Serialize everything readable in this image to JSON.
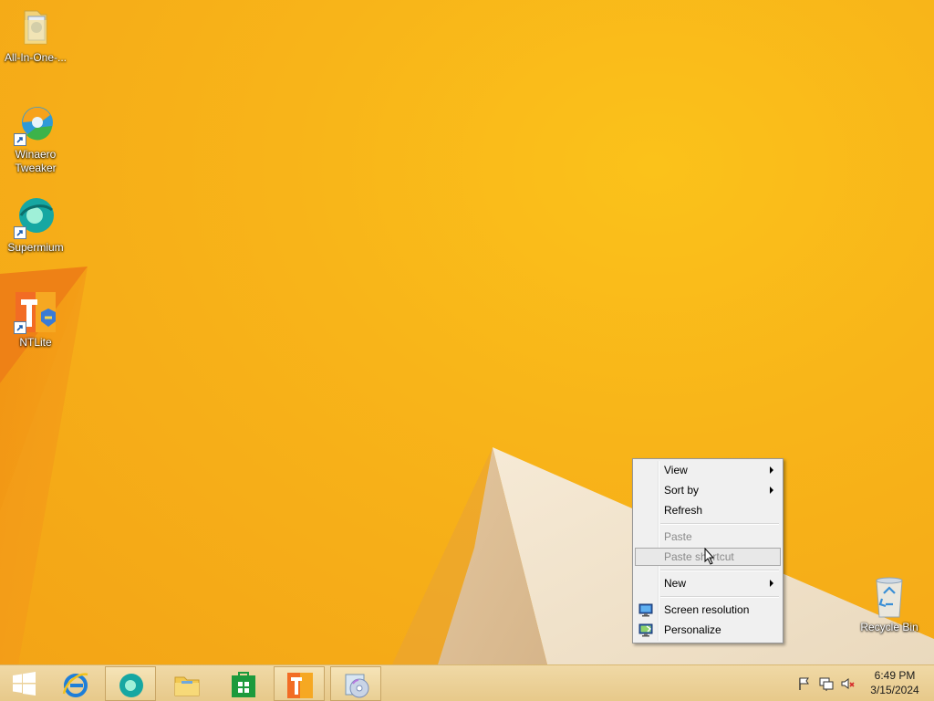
{
  "desktop": {
    "icons": [
      {
        "label": "All-In-One-...",
        "icon": "folder-icon"
      },
      {
        "label": "Winaero\nTweaker",
        "icon": "winaero-tweaker-icon"
      },
      {
        "label": "Supermium",
        "icon": "supermium-icon"
      },
      {
        "label": "NTLite",
        "icon": "ntlite-icon"
      },
      {
        "label": "Recycle Bin",
        "icon": "recycle-bin-icon"
      }
    ]
  },
  "context_menu": {
    "items": [
      {
        "label": "View",
        "submenu": true,
        "enabled": true
      },
      {
        "label": "Sort by",
        "submenu": true,
        "enabled": true
      },
      {
        "label": "Refresh",
        "submenu": false,
        "enabled": true
      },
      {
        "label": "Paste",
        "submenu": false,
        "enabled": false
      },
      {
        "label": "Paste shortcut",
        "submenu": false,
        "enabled": false,
        "highlighted": true
      },
      {
        "label": "New",
        "submenu": true,
        "enabled": true
      },
      {
        "label": "Screen resolution",
        "submenu": false,
        "enabled": true,
        "icon": "display-icon"
      },
      {
        "label": "Personalize",
        "submenu": false,
        "enabled": true,
        "icon": "personalize-icon"
      }
    ]
  },
  "taskbar": {
    "buttons": [
      {
        "name": "start-button",
        "icon": "windows-logo-icon"
      },
      {
        "name": "internet-explorer",
        "icon": "internet-explorer-icon"
      },
      {
        "name": "supermium",
        "icon": "supermium-icon",
        "active": true
      },
      {
        "name": "file-explorer",
        "icon": "file-explorer-icon"
      },
      {
        "name": "store",
        "icon": "store-icon"
      },
      {
        "name": "ntlite",
        "icon": "ntlite-icon",
        "active": true
      },
      {
        "name": "disc-app",
        "icon": "disc-icon",
        "active": true
      }
    ],
    "tray": {
      "icons": [
        "flag-icon",
        "network-icon",
        "volume-muted-icon"
      ],
      "time": "6:49 PM",
      "date": "3/15/2024"
    }
  },
  "colors": {
    "wallpaper": "#f8b419",
    "taskbar": "#ebcf93"
  }
}
